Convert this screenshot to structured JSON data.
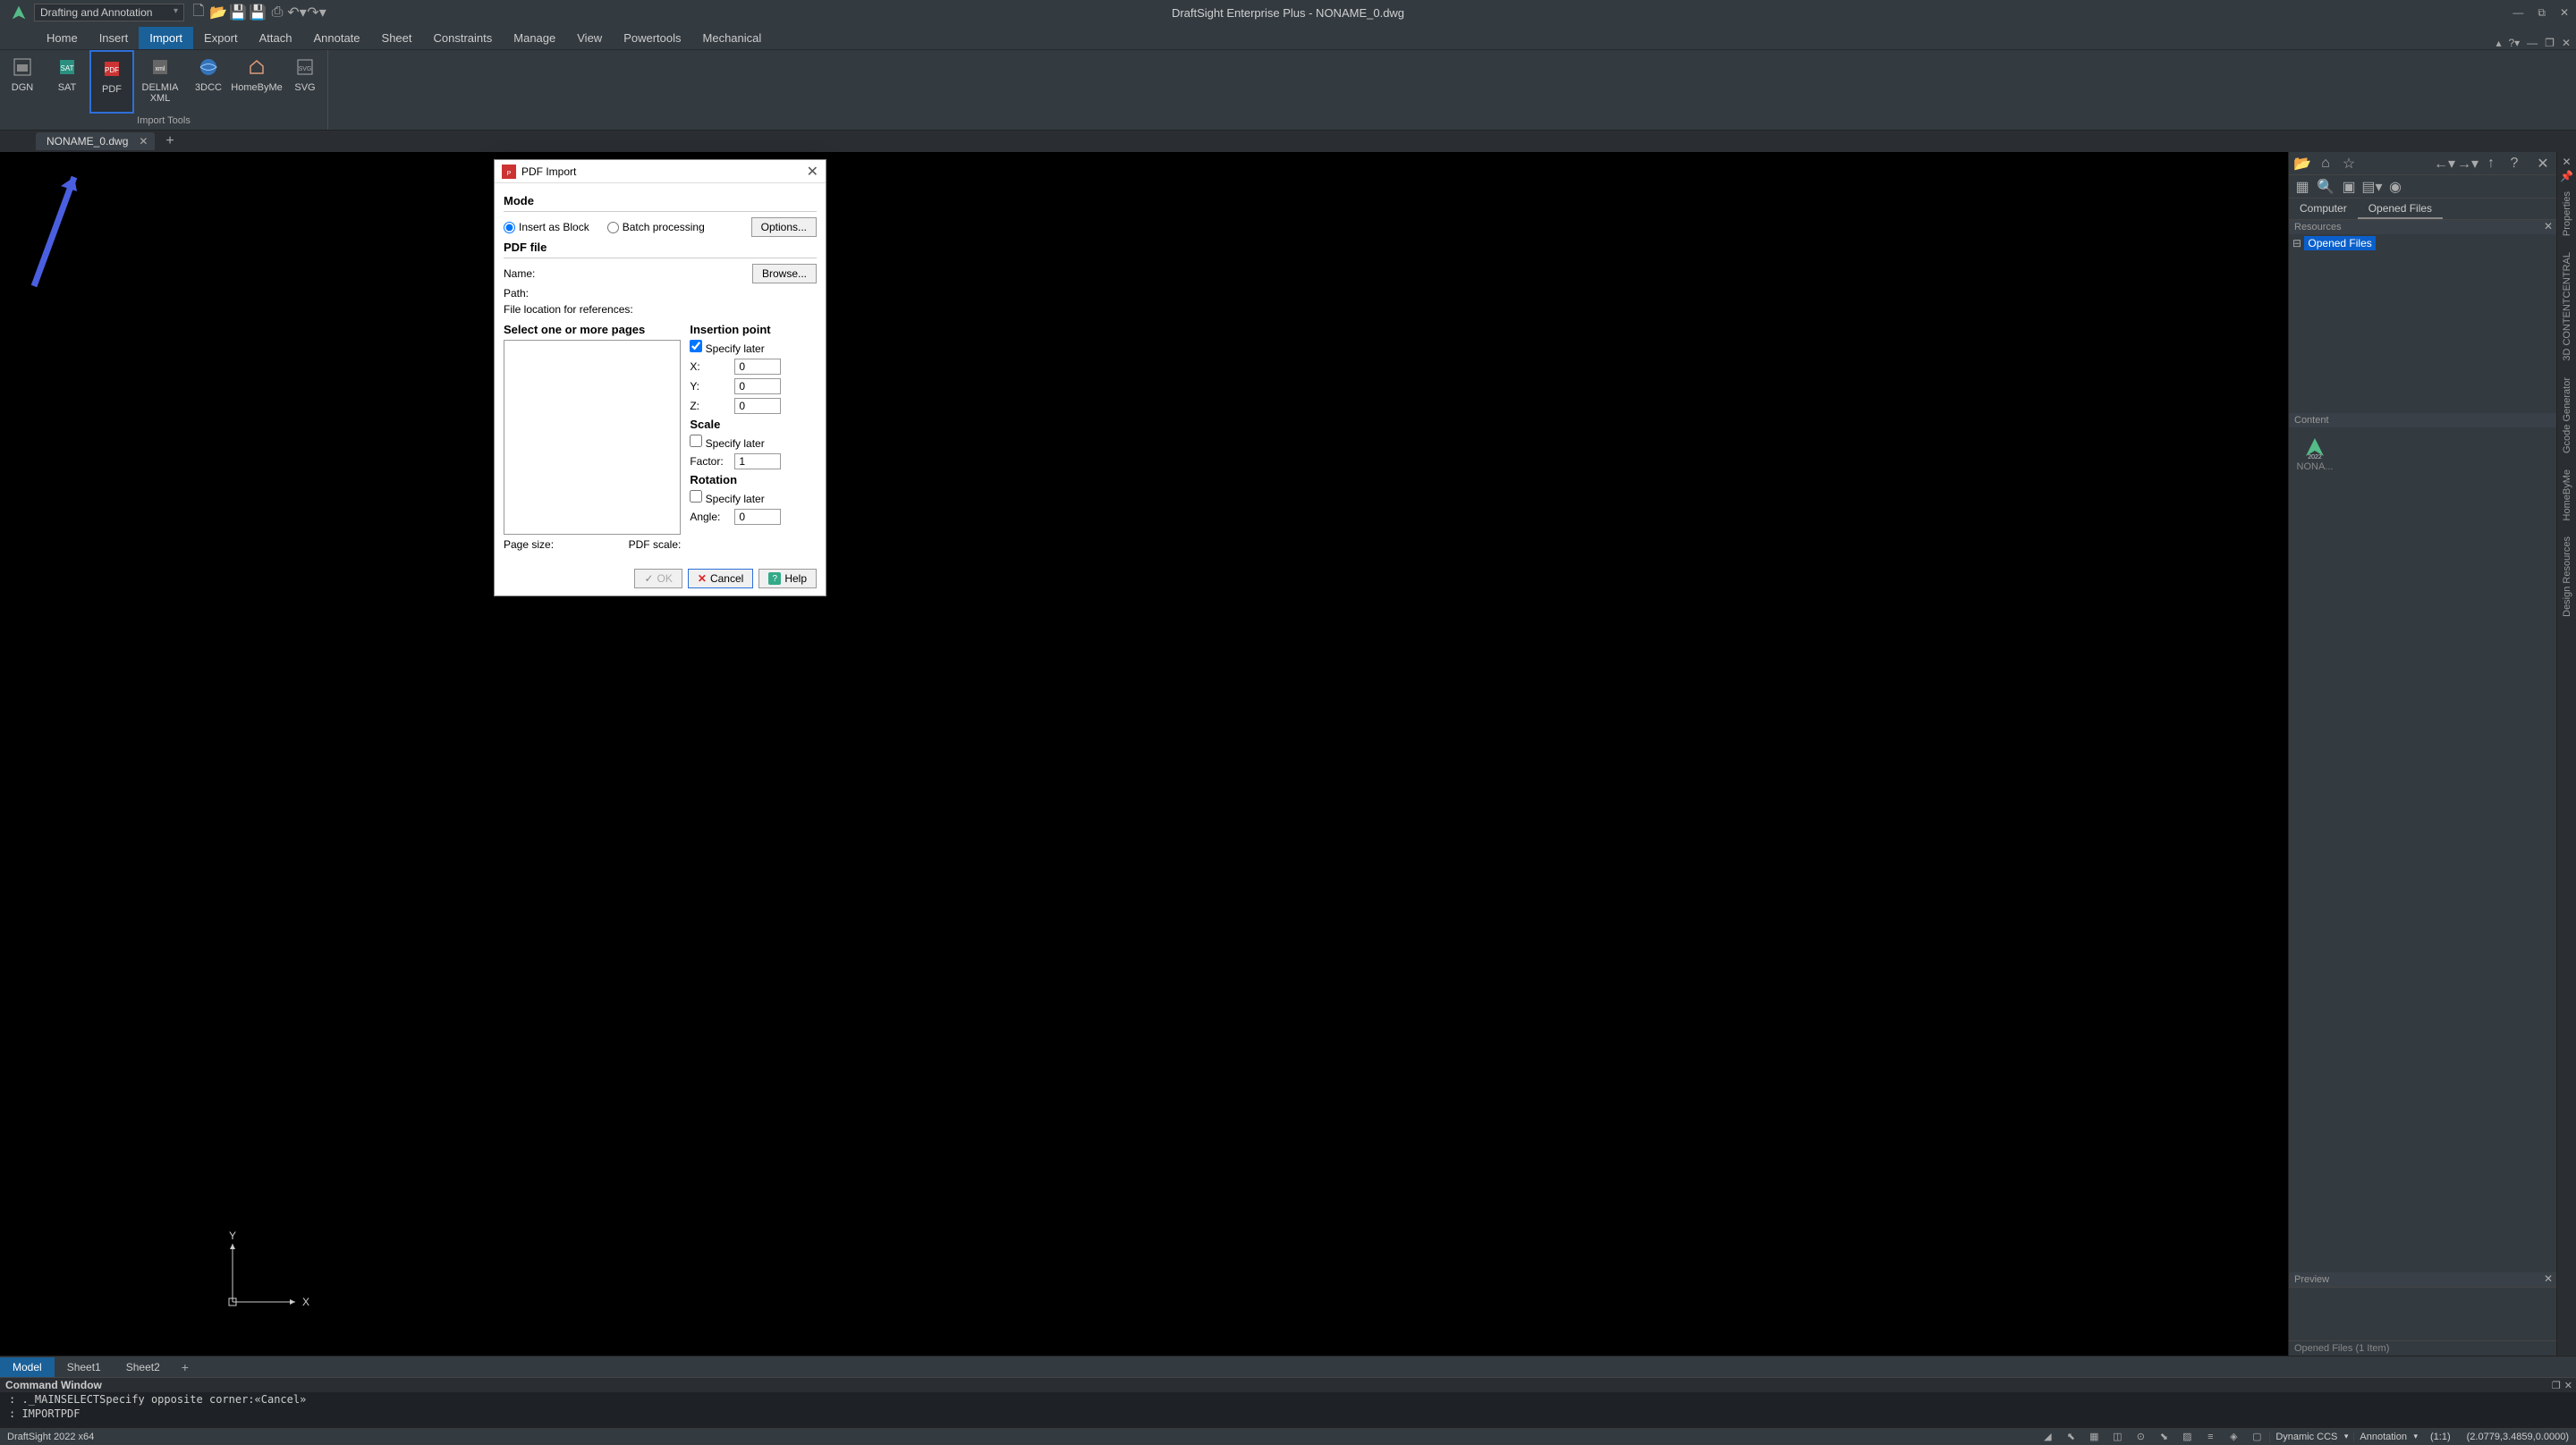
{
  "titlebar": {
    "workspace": "Drafting and Annotation",
    "title": "DraftSight Enterprise Plus - NONAME_0.dwg"
  },
  "menu": {
    "tabs": [
      "Home",
      "Insert",
      "Import",
      "Export",
      "Attach",
      "Annotate",
      "Sheet",
      "Constraints",
      "Manage",
      "View",
      "Powertools",
      "Mechanical"
    ],
    "active": "Import"
  },
  "ribbon": {
    "group_title": "Import Tools",
    "items": [
      {
        "label": "DGN"
      },
      {
        "label": "SAT"
      },
      {
        "label": "PDF"
      },
      {
        "label": "DELMIA\nXML"
      },
      {
        "label": "3DCC"
      },
      {
        "label": "HomeByMe"
      },
      {
        "label": "SVG"
      }
    ]
  },
  "doctab": {
    "name": "NONAME_0.dwg"
  },
  "rightpanel": {
    "tabs": [
      "Computer",
      "Opened Files"
    ],
    "active_tab": "Opened Files",
    "resources_hdr": "Resources",
    "tree_item": "Opened Files",
    "content_hdr": "Content",
    "thumb_label": "NONA...",
    "preview_hdr": "Preview",
    "footer": "Opened Files (1 Item)"
  },
  "vtabs": [
    "Properties",
    "3D CONTENTCENTRAL",
    "Gcode Generator",
    "HomeByMe",
    "Design Resources"
  ],
  "sheets": {
    "tabs": [
      "Model",
      "Sheet1",
      "Sheet2"
    ],
    "active": "Model"
  },
  "cmdwin": {
    "title": "Command Window",
    "line1": ": ._MAINSELECTSpecify opposite corner:«Cancel»",
    "line2": ": IMPORTPDF"
  },
  "statusbar": {
    "left": "DraftSight 2022 x64",
    "dcc": "Dynamic CCS",
    "annoscale": "Annotation",
    "ratio": "(1:1)",
    "coords": "(2.0779,3.4859,0.0000)"
  },
  "dialog": {
    "title": "PDF Import",
    "mode_hdr": "Mode",
    "mode_insert": "Insert as Block",
    "mode_batch": "Batch processing",
    "options_btn": "Options...",
    "pdffile_hdr": "PDF file",
    "name_lbl": "Name:",
    "browse_btn": "Browse...",
    "path_lbl": "Path:",
    "fileloc_lbl": "File location for references:",
    "pages_hdr": "Select one or more pages",
    "insertion_hdr": "Insertion point",
    "specify_later": "Specify later",
    "x_lbl": "X:",
    "x_val": "0",
    "y_lbl": "Y:",
    "y_val": "0",
    "z_lbl": "Z:",
    "z_val": "0",
    "scale_hdr": "Scale",
    "factor_lbl": "Factor:",
    "factor_val": "1",
    "rotation_hdr": "Rotation",
    "angle_lbl": "Angle:",
    "angle_val": "0",
    "pagesize_lbl": "Page size:",
    "pdfscale_lbl": "PDF scale:",
    "ok": "OK",
    "cancel": "Cancel",
    "help": "Help"
  }
}
